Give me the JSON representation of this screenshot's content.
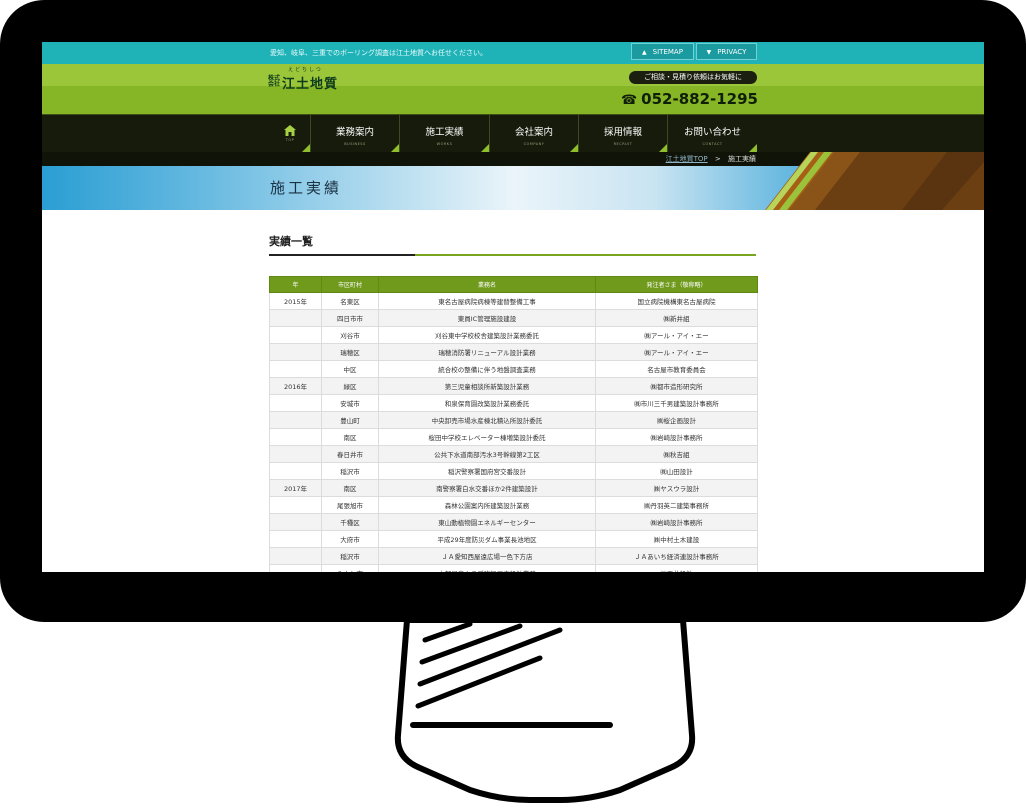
{
  "header": {
    "tagline": "愛知、岐阜、三重でのボーリング調査は江土地質へお任せください。",
    "sitemap_label": "SITEMAP",
    "privacy_label": "PRIVACY",
    "logo_ruby": "えどちしつ",
    "logo_small": "株式会社",
    "logo_name": "江土地質",
    "consult_label": "ご相談・見積り依頼はお気軽に",
    "phone": "052-882-1295"
  },
  "nav": {
    "items": [
      {
        "label": "業務案内",
        "en": "BUSINESS"
      },
      {
        "label": "施工実績",
        "en": "WORKS"
      },
      {
        "label": "会社案内",
        "en": "COMPANY"
      },
      {
        "label": "採用情報",
        "en": "RECRUIT"
      },
      {
        "label": "お問い合わせ",
        "en": "CONTACT"
      }
    ],
    "home_en": "TOP"
  },
  "breadcrumb": {
    "home": "江土地質TOP",
    "separator": ">",
    "current": "施工実績"
  },
  "page_title": "施工実績",
  "section_title": "実績一覧",
  "table": {
    "headers": [
      "年",
      "市区町村",
      "業務名",
      "発注者さま（敬称略）"
    ],
    "rows": [
      [
        "2015年",
        "名東区",
        "東名古屋病院病棟等建替整備工事",
        "国立病院機構東名古屋病院"
      ],
      [
        "",
        "四日市市",
        "東員IC管理施設建設",
        "㈱新井組"
      ],
      [
        "",
        "刈谷市",
        "刈谷東中学校校舎建築設計業務委託",
        "㈱アール・アイ・エー"
      ],
      [
        "",
        "瑞穂区",
        "瑞穂消防署リニューアル設計業務",
        "㈱アール・アイ・エー"
      ],
      [
        "",
        "中区",
        "統合校の整備に伴う地盤調査業務",
        "名古屋市教育委員会"
      ],
      [
        "2016年",
        "緑区",
        "第三児童相談所新築設計業務",
        "㈱都市造形研究所"
      ],
      [
        "",
        "安城市",
        "和泉保育園改築設計業務委託",
        "㈱市川三千男建築設計事務所"
      ],
      [
        "",
        "豊山町",
        "中央卸売市場水産棟北積込所設計委託",
        "㈱桜企画設計"
      ],
      [
        "",
        "南区",
        "桜田中学校エレベーター棟増築設計委託",
        "㈱岩崎設計事務所"
      ],
      [
        "",
        "春日井市",
        "公共下水道南部汚水3号幹線第2工区",
        "㈱秋吉組"
      ],
      [
        "",
        "稲沢市",
        "稲沢警察署国府宮交番設計",
        "㈱山田設計"
      ],
      [
        "2017年",
        "南区",
        "南警察署白水交番ほか2件建築設計",
        "㈱ヤスウラ設計"
      ],
      [
        "",
        "尾張旭市",
        "森林公園案内所建築設計業務",
        "㈱丹羽英二建築事務所"
      ],
      [
        "",
        "千種区",
        "東山動植物園エネルギーセンター",
        "㈱岩崎設計事務所"
      ],
      [
        "",
        "大府市",
        "平成29年度防災ダム事業長池地区",
        "㈱中村土木建設"
      ],
      [
        "",
        "稲沢市",
        "ＪＡ愛知西屋遠広場一色下方店",
        "ＪＡあいち経済連設計事務所"
      ],
      [
        "",
        "みよし市",
        "中部児童クラブ建設工事設計業務",
        "㈱玉井設計"
      ]
    ]
  },
  "colors": {
    "teal": "#1fb3b8",
    "green": "#86b526",
    "nav_dark": "#161b0b",
    "table_header": "#6f9a1c"
  }
}
